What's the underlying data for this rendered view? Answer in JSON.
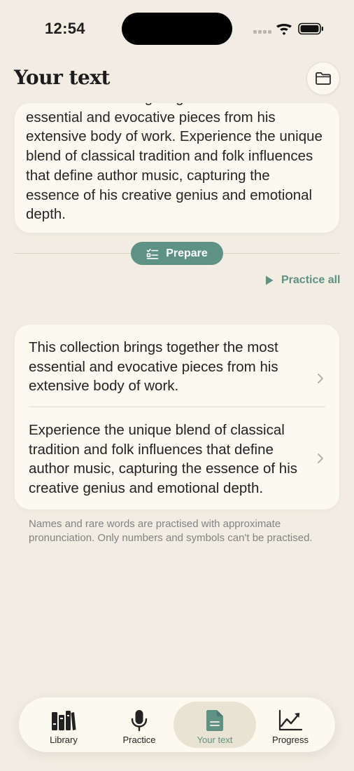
{
  "status_bar": {
    "time": "12:54"
  },
  "header": {
    "title": "Your text"
  },
  "editor": {
    "text": "This collection brings together the most essential and evocative pieces from his extensive body of work. Experience the unique blend of classical tradition and folk influences that define author music, capturing the essence of his creative genius and emotional depth."
  },
  "actions": {
    "prepare_label": "Prepare",
    "practice_all_label": "Practice all"
  },
  "sentences": [
    {
      "text": "This collection brings together the most essential and evocative pieces from his extensive body of work."
    },
    {
      "text": "Experience the unique blend of classical tradition and folk influences that define author music, capturing the essence of his creative genius and emotional depth."
    }
  ],
  "footnote": "Names and rare words are practised with approximate pronunciation. Only numbers and symbols can't be practised.",
  "tabs": [
    {
      "label": "Library",
      "icon": "library-icon"
    },
    {
      "label": "Practice",
      "icon": "microphone-icon"
    },
    {
      "label": "Your text",
      "icon": "document-icon",
      "active": true
    },
    {
      "label": "Progress",
      "icon": "chart-line-icon"
    }
  ],
  "colors": {
    "accent": "#5e9284",
    "background": "#f1ede2",
    "card": "#fcf9f1"
  }
}
